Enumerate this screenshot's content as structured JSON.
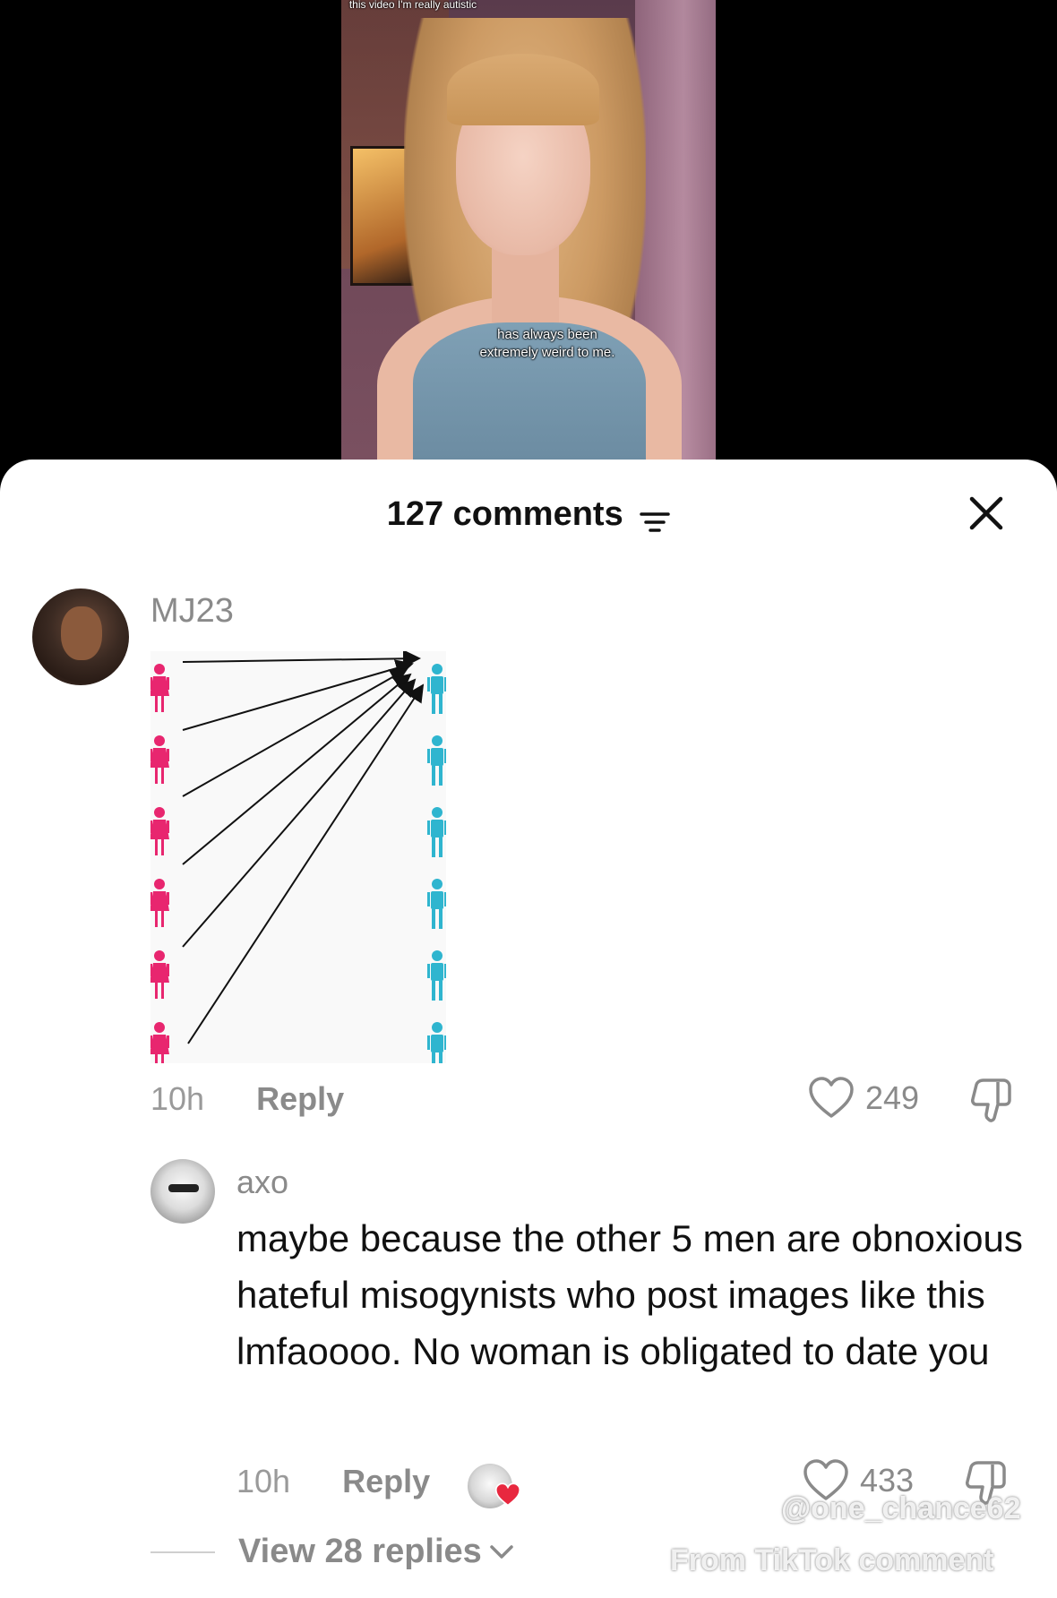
{
  "video": {
    "caption_top": "this video I'm really autistic",
    "caption_mid": "has always been extremely weird to me."
  },
  "sheet": {
    "title": "127 comments",
    "sort_icon": "sort-lines-icon",
    "close_icon": "close-x-icon"
  },
  "comments": [
    {
      "username": "MJ23",
      "time": "10h",
      "reply_label": "Reply",
      "likes": "249",
      "image": {
        "description_icons": [
          "woman-figure-icon",
          "man-figure-icon",
          "arrow-icon"
        ],
        "colors": {
          "woman": "#e8266f",
          "man": "#2fb5cf"
        }
      }
    },
    {
      "username": "axo",
      "text": "maybe because the other 5 men are obnoxious hateful misogynists who post images like this lmfaoooo. No woman is obligated to date you",
      "time": "10h",
      "reply_label": "Reply",
      "likes": "433",
      "view_replies": "View 28 replies"
    }
  ],
  "watermark": {
    "handle": "@one_chance62",
    "source": "From TikTok comment"
  },
  "colors": {
    "sheet_bg": "#ffffff",
    "muted_text": "#8a8a8a",
    "heart_badge": "#e8283f"
  }
}
